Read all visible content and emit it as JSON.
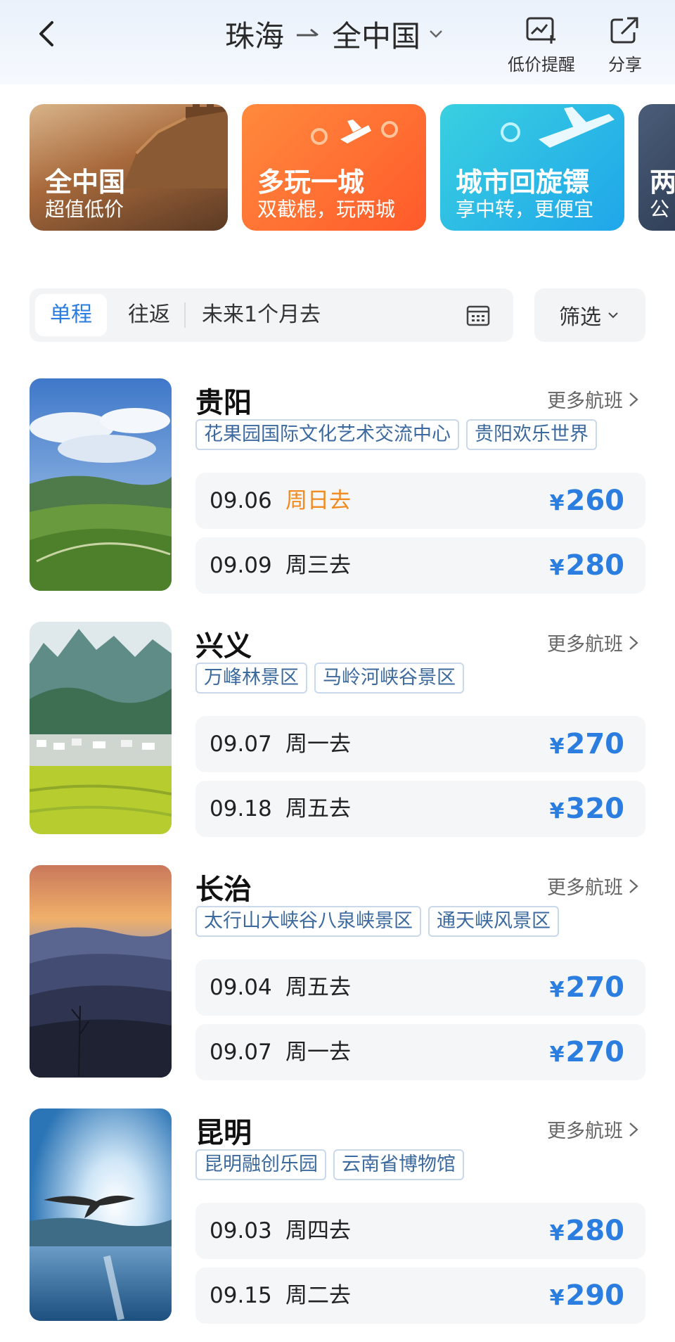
{
  "header": {
    "origin": "珠海",
    "destination": "全中国",
    "alert_label": "低价提醒",
    "share_label": "分享"
  },
  "banners": [
    {
      "title": "全中国",
      "subtitle": "超值低价"
    },
    {
      "title": "多玩一城",
      "subtitle": "双截棍，玩两城"
    },
    {
      "title": "城市回旋镖",
      "subtitle": "享中转，更便宜"
    },
    {
      "title": "两",
      "subtitle": "公"
    }
  ],
  "filter": {
    "one_way": "单程",
    "round_trip": "往返",
    "date_range": "未来1个月去",
    "filter_label": "筛选"
  },
  "more_flights_label": "更多航班",
  "destinations": [
    {
      "city": "贵阳",
      "tags": [
        "花果园国际文化艺术交流中心",
        "贵阳欢乐世界"
      ],
      "flights": [
        {
          "date": "09.06",
          "day": "周日去",
          "price": "260",
          "highlight": true
        },
        {
          "date": "09.09",
          "day": "周三去",
          "price": "280",
          "highlight": false
        }
      ]
    },
    {
      "city": "兴义",
      "tags": [
        "万峰林景区",
        "马岭河峡谷景区"
      ],
      "flights": [
        {
          "date": "09.07",
          "day": "周一去",
          "price": "270",
          "highlight": false
        },
        {
          "date": "09.18",
          "day": "周五去",
          "price": "320",
          "highlight": false
        }
      ]
    },
    {
      "city": "长治",
      "tags": [
        "太行山大峡谷八泉峡景区",
        "通天峡风景区"
      ],
      "flights": [
        {
          "date": "09.04",
          "day": "周五去",
          "price": "270",
          "highlight": false
        },
        {
          "date": "09.07",
          "day": "周一去",
          "price": "270",
          "highlight": false
        }
      ]
    },
    {
      "city": "昆明",
      "tags": [
        "昆明融创乐园",
        "云南省博物馆"
      ],
      "flights": [
        {
          "date": "09.03",
          "day": "周四去",
          "price": "280",
          "highlight": false
        },
        {
          "date": "09.15",
          "day": "周二去",
          "price": "290",
          "highlight": false
        }
      ]
    }
  ],
  "currency_symbol": "¥",
  "colors": {
    "accent_blue": "#2b7de0",
    "highlight_orange": "#f18a1f",
    "tag_text": "#3c6a9e"
  }
}
